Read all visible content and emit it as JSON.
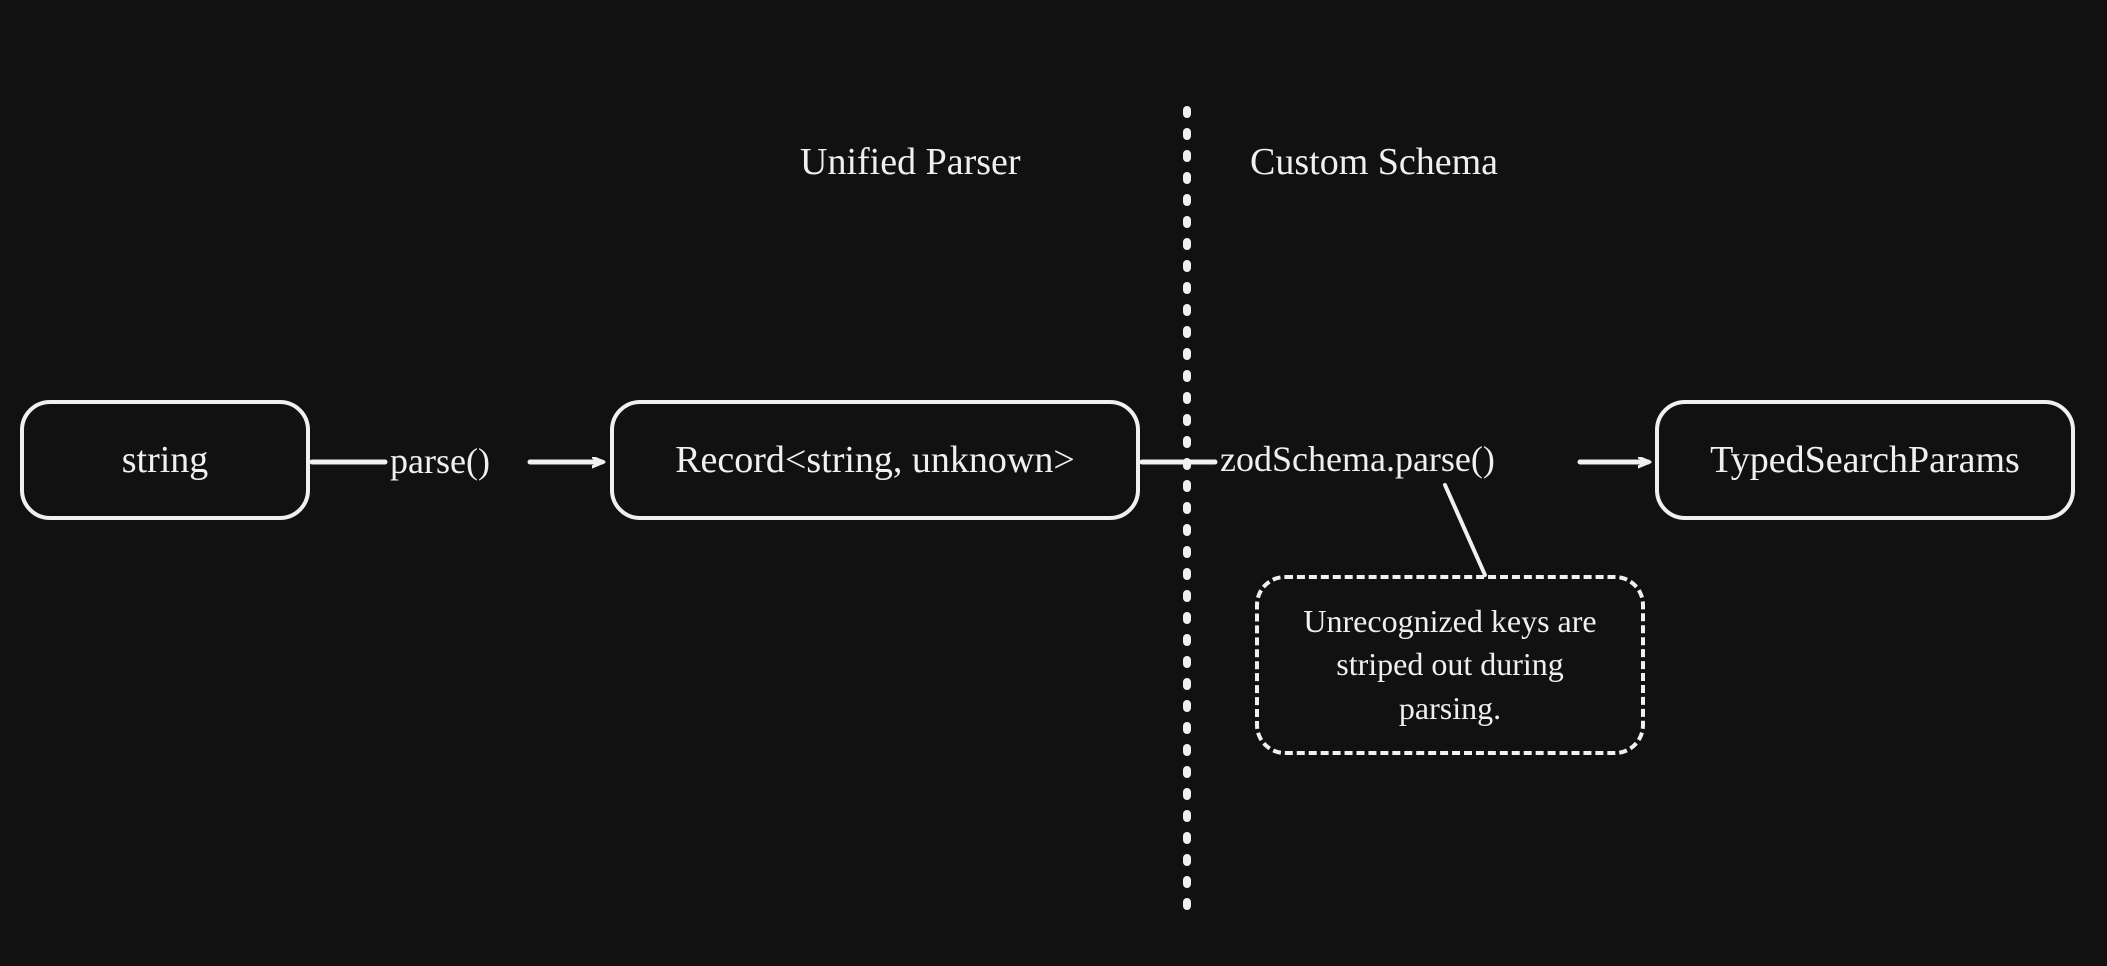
{
  "sections": {
    "left": "Unified Parser",
    "right": "Custom Schema"
  },
  "nodes": {
    "string": "string",
    "record": "Record<string, unknown>",
    "typed": "TypedSearchParams"
  },
  "edges": {
    "parse": "parse()",
    "zodParse": "zodSchema.parse()"
  },
  "note": "Unrecognized keys are striped out during parsing."
}
